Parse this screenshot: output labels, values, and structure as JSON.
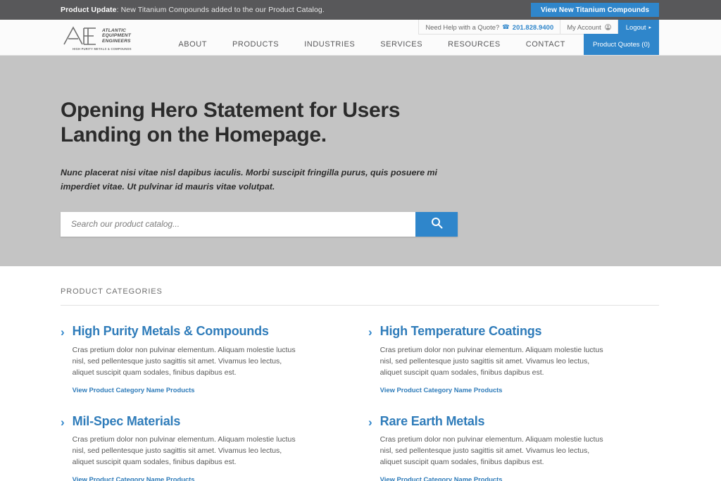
{
  "announcement": {
    "label": "Product Update",
    "text": ": New Titanium Compounds added to the our Product Catalog.",
    "button_label": "View New Titanium Compounds"
  },
  "header": {
    "logo": {
      "monogram": "AEE",
      "line1": "ATLANTIC",
      "line2": "EQUIPMENT",
      "line3": "ENGINEERS",
      "tagline": "HIGH PURITY METALS & COMPOUNDS"
    },
    "utility": {
      "quote_label": "Need Help with a Quote?",
      "phone": "201.828.9400",
      "account_label": "My Account",
      "logout_label": "Logout",
      "logout_caret": "▸"
    },
    "nav": [
      {
        "label": "ABOUT"
      },
      {
        "label": "PRODUCTS"
      },
      {
        "label": "INDUSTRIES"
      },
      {
        "label": "SERVICES"
      },
      {
        "label": "RESOURCES"
      },
      {
        "label": "CONTACT"
      }
    ],
    "quotes_button": "Product Quotes (0)"
  },
  "hero": {
    "heading": "Opening Hero Statement for Users Landing on the Homepage.",
    "subheading": "Nunc placerat nisi vitae nisl dapibus iaculis. Morbi suscipit fringilla purus, quis posuere mi imperdiet vitae. Ut pulvinar id mauris vitae volutpat.",
    "search_placeholder": "Search our product catalog...",
    "search_value": ""
  },
  "categories": {
    "heading": "PRODUCT CATEGORIES",
    "chevron": "›",
    "items": [
      {
        "title": "High Purity Metals & Compounds",
        "description": "Cras pretium dolor non pulvinar elementum. Aliquam molestie luctus nisl, sed pellentesque justo sagittis sit amet. Vivamus leo lectus, aliquet suscipit quam sodales, finibus dapibus est.",
        "link": "View Product Category Name Products"
      },
      {
        "title": "High Temperature Coatings",
        "description": "Cras pretium dolor non pulvinar elementum. Aliquam molestie luctus nisl, sed pellentesque justo sagittis sit amet. Vivamus leo lectus, aliquet suscipit quam sodales, finibus dapibus est.",
        "link": "View Product Category Name Products"
      },
      {
        "title": "Mil-Spec Materials",
        "description": "Cras pretium dolor non pulvinar elementum. Aliquam molestie luctus nisl, sed pellentesque justo sagittis sit amet. Vivamus leo lectus, aliquet suscipit quam sodales, finibus dapibus est.",
        "link": "View Product Category Name Products"
      },
      {
        "title": "Rare Earth Metals",
        "description": "Cras pretium dolor non pulvinar elementum. Aliquam molestie luctus nisl, sed pellentesque justo sagittis sit amet. Vivamus leo lectus, aliquet suscipit quam sodales, finibus dapibus est.",
        "link": "View Product Category Name Products"
      }
    ]
  },
  "colors": {
    "accent_blue": "#2f86cb",
    "link_blue": "#2f7cba",
    "announce_bar": "#58585a",
    "hero_bg": "#c4c4c4"
  }
}
